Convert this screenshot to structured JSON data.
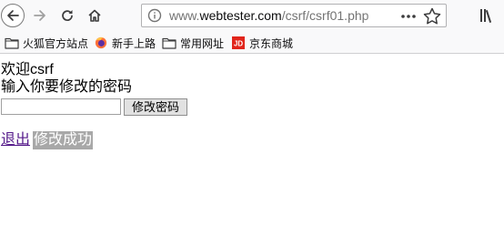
{
  "browser": {
    "url_prefix": "www.",
    "url_host": "webtester.com",
    "url_path": "/csrf/csrf01.php",
    "more_label": "•••"
  },
  "bookmarks": [
    {
      "label": "火狐官方站点",
      "icon": "folder-icon"
    },
    {
      "label": "新手上路",
      "icon": "firefox-icon"
    },
    {
      "label": "常用网址",
      "icon": "folder-icon"
    },
    {
      "label": "京东商城",
      "icon": "jd-icon",
      "badge": "JD"
    }
  ],
  "page": {
    "welcome_text": "欢迎csrf",
    "prompt_text": "输入你要修改的密码",
    "password_value": "",
    "submit_label": "修改密码",
    "logout_label": "退出",
    "success_message": "修改成功"
  },
  "colors": {
    "toolbar_bg": "#f9f9fa",
    "visited_link": "#551a8b",
    "message_bg": "#a8a8a8",
    "jd_red": "#e1251b"
  }
}
